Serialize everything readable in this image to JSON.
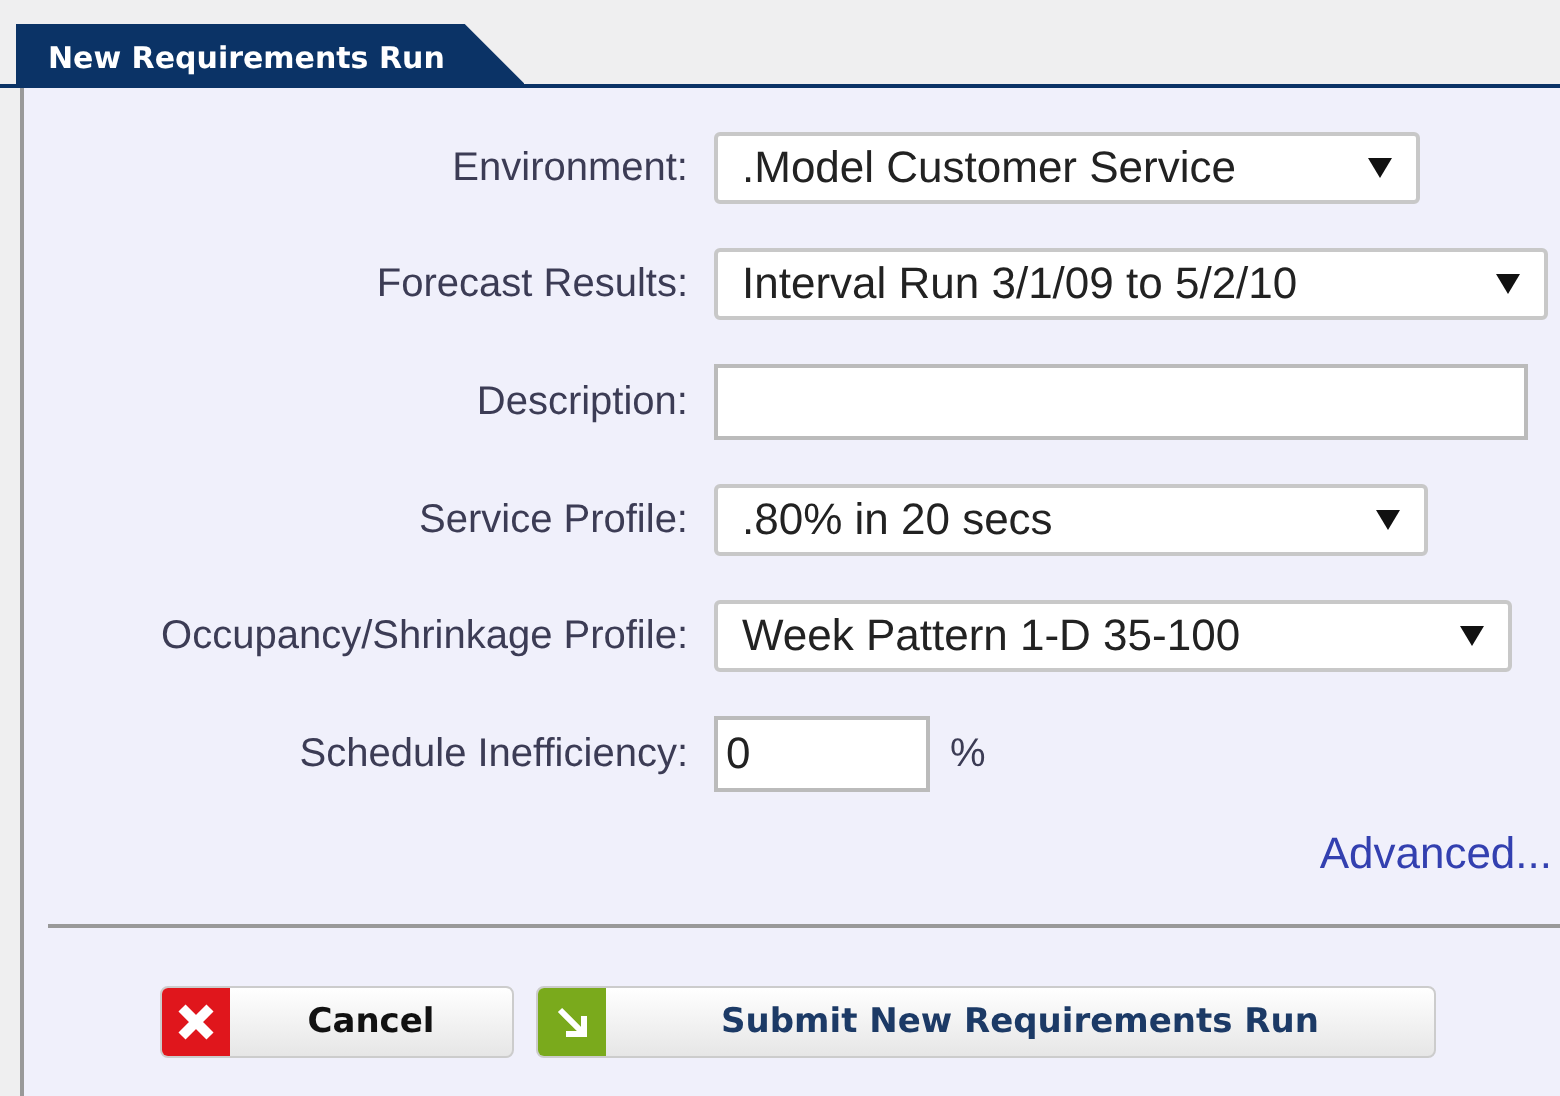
{
  "panel": {
    "title": "New Requirements Run"
  },
  "fields": [
    {
      "kind": "select",
      "label": "Environment:",
      "value": ".Model Customer Service"
    },
    {
      "kind": "select",
      "label": "Forecast Results:",
      "value": "Interval Run 3/1/09 to 5/2/10"
    },
    {
      "kind": "text",
      "label": "Description:"
    },
    {
      "kind": "select",
      "label": "Service Profile:",
      "value": ".80% in 20 secs"
    },
    {
      "kind": "select",
      "label": "Occupancy/Shrinkage Profile:",
      "value": "Week Pattern 1-D 35-100"
    },
    {
      "kind": "percent",
      "label": "Schedule Inefficiency:",
      "value": "0",
      "unit": "%"
    }
  ],
  "advanced_link": "Advanced...",
  "buttons": [
    {
      "kind": "cancel",
      "label": "Cancel"
    },
    {
      "kind": "submit",
      "label": "Submit New Requirements Run"
    }
  ]
}
